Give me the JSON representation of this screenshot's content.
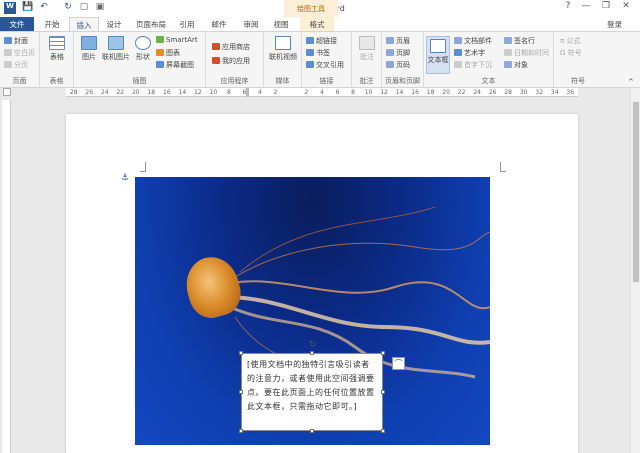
{
  "window": {
    "title": "文档1 - Word",
    "minimize": "—",
    "restore": "❐",
    "close": "✕",
    "help": "?"
  },
  "quick_access": {
    "save": "💾",
    "undo": "↶",
    "redo": "↷",
    "repeat": "↻",
    "new": "▢",
    "open": "▣"
  },
  "context_tab": {
    "label": "绘图工具"
  },
  "tabs": {
    "file": "文件",
    "home": "开始",
    "insert": "插入",
    "design": "设计",
    "layout": "页面布局",
    "references": "引用",
    "mailings": "邮件",
    "review": "审阅",
    "view": "视图",
    "format": "格式"
  },
  "account": {
    "login": "登录"
  },
  "ribbon": {
    "pages": {
      "label": "页面",
      "cover": "封面",
      "blank": "空白页",
      "break": "分页"
    },
    "tables": {
      "label": "表格",
      "table": "表格"
    },
    "illustrations": {
      "label": "插图",
      "pictures": "图片",
      "online_pictures": "联机图片",
      "shapes": "形状",
      "smartart": "SmartArt",
      "chart": "图表",
      "screenshot": "屏幕截图"
    },
    "apps": {
      "label": "应用程序",
      "store": "应用商店",
      "my_apps": "我的应用"
    },
    "media": {
      "label": "媒体",
      "online_video": "联机视频"
    },
    "links": {
      "label": "链接",
      "hyperlink": "超链接",
      "bookmark": "书签",
      "cross_ref": "交叉引用"
    },
    "comments": {
      "label": "批注",
      "comment": "批注"
    },
    "header_footer": {
      "label": "页眉和页脚",
      "header": "页眉",
      "footer": "页脚",
      "page_number": "页码"
    },
    "text": {
      "label": "文本",
      "textbox": "文本框",
      "quick_parts": "文档部件",
      "wordart": "艺术字",
      "dropcap": "首字下沉",
      "signature": "签名行",
      "datetime": "日期和时间",
      "object": "对象"
    },
    "symbols": {
      "label": "符号",
      "equation": "公式",
      "symbol": "符号",
      "equation_icon": "π",
      "symbol_icon": "Ω"
    }
  },
  "ruler": {
    "ticks": [
      "28",
      "26",
      "24",
      "22",
      "20",
      "18",
      "16",
      "14",
      "12",
      "10",
      "8",
      "6",
      "4",
      "2",
      "",
      "2",
      "4",
      "6",
      "8",
      "10",
      "12",
      "14",
      "16",
      "18",
      "20",
      "22",
      "24",
      "26",
      "28",
      "30",
      "32",
      "34",
      "36"
    ]
  },
  "document": {
    "quote_text": "[使用文档中的独特引言吸引读者的注意力，或者使用此空间强调要点。要在此页面上的任何位置放置此文本框，只需拖动它即可。]",
    "anchor": "⚓",
    "rotate": "↻",
    "layout_options": "⌒"
  },
  "colors": {
    "accent": "#2b579a",
    "context_tab": "#fcefd6",
    "ribbon": "#f5f5f5"
  }
}
